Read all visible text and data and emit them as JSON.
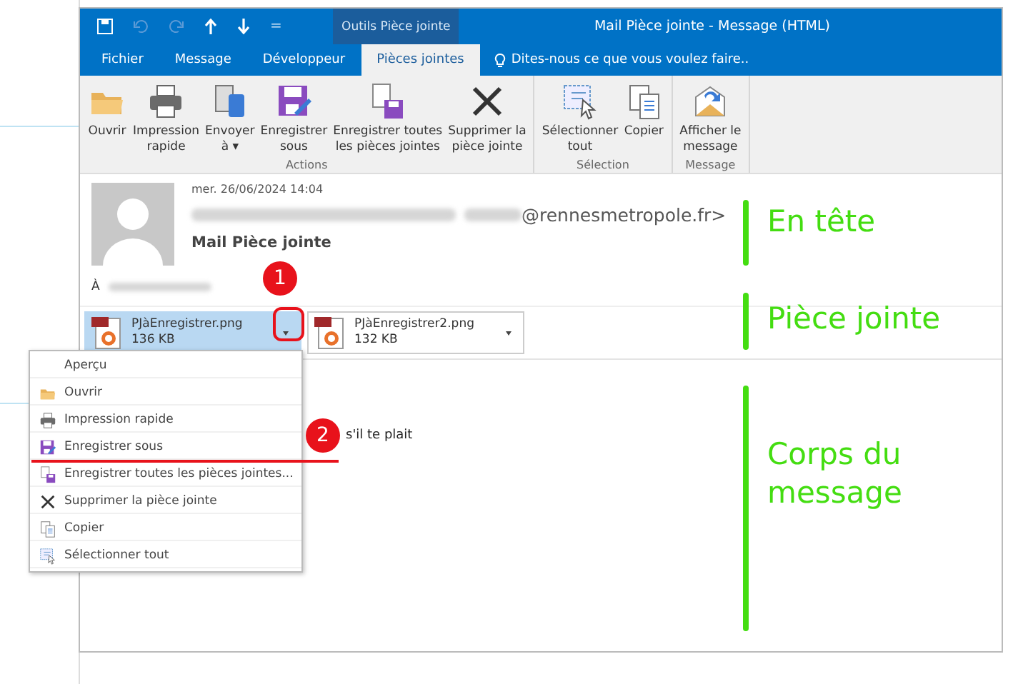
{
  "window": {
    "title": "Mail Pièce jointe - Message (HTML)",
    "context_tab": "Outils Pièce jointe",
    "quick_access_more": "="
  },
  "tabs": [
    {
      "label": "Fichier",
      "selected": false
    },
    {
      "label": "Message",
      "selected": false
    },
    {
      "label": "Développeur",
      "selected": false
    },
    {
      "label": "Pièces jointes",
      "selected": true
    }
  ],
  "tell_me": "Dites-nous ce que vous voulez faire..",
  "ribbon": [
    {
      "label": "Actions",
      "buttons": [
        {
          "kind": "open",
          "lines": [
            "Ouvrir"
          ]
        },
        {
          "kind": "print",
          "lines": [
            "Impression",
            "rapide"
          ]
        },
        {
          "kind": "send",
          "lines": [
            "Envoyer",
            "à ▾"
          ]
        },
        {
          "kind": "save",
          "lines": [
            "Enregistrer",
            "sous"
          ]
        },
        {
          "kind": "save_all",
          "lines": [
            "Enregistrer toutes",
            "les pièces jointes"
          ]
        },
        {
          "kind": "delete",
          "lines": [
            "Supprimer la",
            "pièce jointe"
          ]
        }
      ]
    },
    {
      "label": "Sélection",
      "buttons": [
        {
          "kind": "select_all",
          "lines": [
            "Sélectionner",
            "tout"
          ]
        },
        {
          "kind": "copy",
          "lines": [
            "Copier"
          ]
        }
      ]
    },
    {
      "label": "Message",
      "buttons": [
        {
          "kind": "show_message",
          "lines": [
            "Afficher le",
            "message"
          ]
        }
      ]
    }
  ],
  "message": {
    "date": "mer. 26/06/2024 14:04",
    "sender_address": "@rennesmetropole.fr>",
    "subject": "Mail Pièce jointe",
    "to_label": "À",
    "body_text": "s'il te plait"
  },
  "attachments": [
    {
      "name": "PJàEnregistrer.png",
      "size": "136 KB",
      "selected": true
    },
    {
      "name": "PJàEnregistrer2.png",
      "size": "132 KB",
      "selected": false
    }
  ],
  "context_menu": [
    {
      "kind": "preview",
      "label": "Aperçu"
    },
    {
      "kind": "open",
      "label": "Ouvrir"
    },
    {
      "kind": "print",
      "label": "Impression rapide"
    },
    {
      "kind": "save",
      "label": "Enregistrer sous"
    },
    {
      "kind": "save_all",
      "label": "Enregistrer toutes les pièces jointes..."
    },
    {
      "kind": "delete",
      "label": "Supprimer la pièce jointe"
    },
    {
      "kind": "copy",
      "label": "Copier"
    },
    {
      "kind": "select_all",
      "label": "Sélectionner tout"
    }
  ],
  "annotations": {
    "markers": [
      "1",
      "2"
    ],
    "labels": [
      "En tête",
      "Pièce jointe",
      "Corps du message"
    ]
  }
}
